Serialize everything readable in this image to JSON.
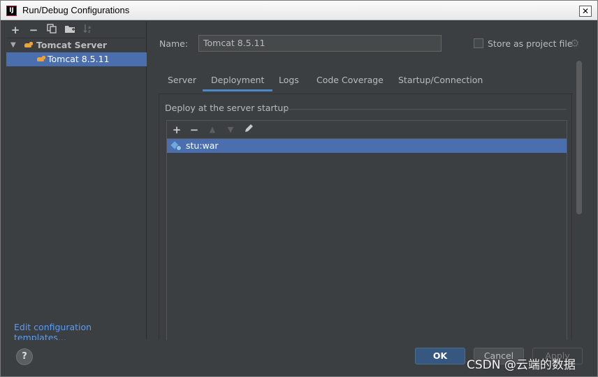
{
  "window": {
    "title": "Run/Debug Configurations",
    "close_glyph": "✕"
  },
  "left": {
    "toolbar": [
      "+",
      "−",
      "copy-icon",
      "folder-icon",
      "sort-icon"
    ],
    "tree": {
      "group_label": "Tomcat Server",
      "item_label": "Tomcat 8.5.11"
    },
    "edit_templates": "Edit configuration templates..."
  },
  "config": {
    "name_label": "Name:",
    "name_value": "Tomcat 8.5.11",
    "store_label": "Store as project file",
    "store_checked": false
  },
  "tabs": [
    "Server",
    "Deployment",
    "Logs",
    "Code Coverage",
    "Startup/Connection"
  ],
  "active_tab": "Deployment",
  "deployment": {
    "section_title": "Deploy at the server startup",
    "items": [
      "stu:war"
    ]
  },
  "buttons": {
    "help": "?",
    "ok": "OK",
    "cancel": "Cancel",
    "apply": "Apply"
  },
  "watermark": "CSDN @云端的数据",
  "colors": {
    "selection": "#4b6eaf",
    "link": "#589df6",
    "ok_button": "#365880",
    "tab_underline": "#4a88c7"
  }
}
